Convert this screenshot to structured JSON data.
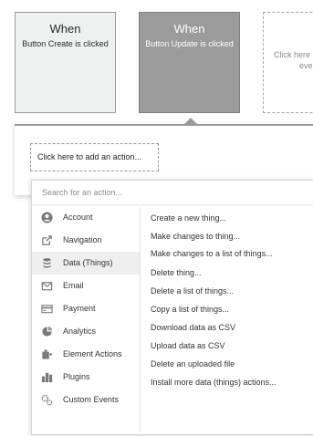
{
  "event_cards": [
    {
      "when": "When",
      "subtitle": "Button Create is clicked"
    },
    {
      "when": "When",
      "subtitle": "Button Update is clicked"
    },
    {
      "subtitle_line1": "Click here",
      "subtitle_line2": "eve"
    }
  ],
  "actions_panel": {
    "add_action_label": "Click here to add an action..."
  },
  "dropdown": {
    "search_placeholder": "Search for an action...",
    "categories": [
      {
        "label": "Account",
        "icon": "account-icon"
      },
      {
        "label": "Navigation",
        "icon": "navigation-icon"
      },
      {
        "label": "Data (Things)",
        "icon": "database-icon",
        "selected": true
      },
      {
        "label": "Email",
        "icon": "email-icon"
      },
      {
        "label": "Payment",
        "icon": "payment-icon"
      },
      {
        "label": "Analytics",
        "icon": "analytics-icon"
      },
      {
        "label": "Element Actions",
        "icon": "element-actions-icon"
      },
      {
        "label": "Plugins",
        "icon": "plugins-icon"
      },
      {
        "label": "Custom Events",
        "icon": "custom-events-icon"
      }
    ],
    "actions": [
      "Create a new thing...",
      "Make changes to thing...",
      "Make changes to a list of things...",
      "Delete thing...",
      "Delete a list of things...",
      "Copy a list of things...",
      "Download data as CSV",
      "Upload data as CSV",
      "Delete an uploaded file",
      "Install more data (things) actions..."
    ]
  },
  "colors": {
    "card_selected": "#9b9b9b",
    "card_default": "#eff1f0",
    "category_active": "#efefef",
    "icon": "#7a7a7a"
  }
}
